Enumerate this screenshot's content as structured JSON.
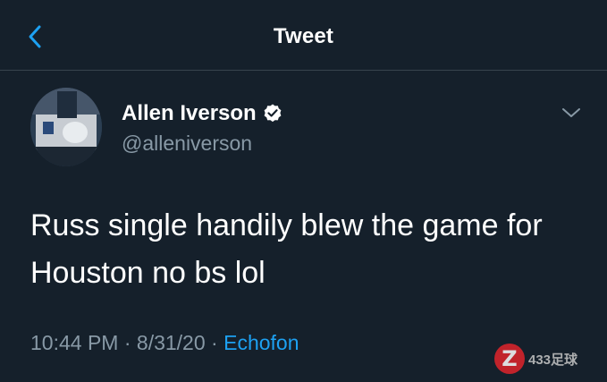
{
  "header": {
    "title": "Tweet",
    "back_icon": "chevron-left-icon"
  },
  "tweet": {
    "author_name": "Allen Iverson",
    "author_handle": "@alleniverson",
    "verified_icon": "verified-badge-icon",
    "menu_icon": "chevron-down-icon",
    "text_line1": "Russ single handily blew the game for",
    "text_line2": "Houston no bs lol",
    "time": "10:44 PM",
    "date": "8/31/20",
    "separator": "·",
    "source": "Echofon"
  },
  "watermark": {
    "logo_letter": "Z",
    "text": "433足球"
  },
  "colors": {
    "background": "#15202b",
    "accent": "#1da1f2",
    "secondary_text": "#8899a6",
    "divider": "#38444d",
    "watermark_red": "#e0242b"
  }
}
